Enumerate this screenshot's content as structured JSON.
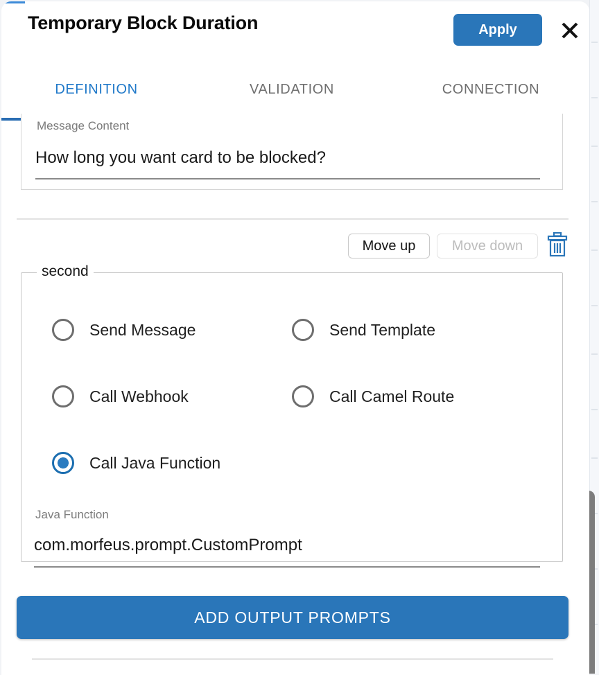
{
  "dialog": {
    "title": "Temporary Block Duration",
    "apply_label": "Apply",
    "close_icon": "close-icon"
  },
  "tabs": [
    {
      "label": "DEFINITION",
      "active": true
    },
    {
      "label": "VALIDATION",
      "active": false
    },
    {
      "label": "CONNECTION",
      "active": false
    }
  ],
  "message_content": {
    "label": "Message Content",
    "value": "How long you want card to be blocked?"
  },
  "item_toolbar": {
    "move_up_label": "Move up",
    "move_down_label": "Move down",
    "move_down_disabled": true,
    "delete_icon": "trash-icon"
  },
  "group": {
    "legend": "second",
    "options": [
      {
        "label": "Send Message",
        "checked": false
      },
      {
        "label": "Send Template",
        "checked": false
      },
      {
        "label": "Call Webhook",
        "checked": false
      },
      {
        "label": "Call Camel Route",
        "checked": false
      },
      {
        "label": "Call Java Function",
        "checked": true
      }
    ],
    "java_function": {
      "label": "Java Function",
      "value": "com.morfeus.prompt.CustomPrompt"
    }
  },
  "add_output_prompts_label": "ADD OUTPUT PROMPTS",
  "colors": {
    "accent_blue": "#2a76b9",
    "tab_active": "#2079c9",
    "tab_inactive": "#6f6f6f",
    "radio_checked": "#1b6eb0",
    "label_gray": "#7b7b7b",
    "disabled_gray": "#bcbcbc",
    "scrollbar_thumb": "#7d7d7d"
  }
}
